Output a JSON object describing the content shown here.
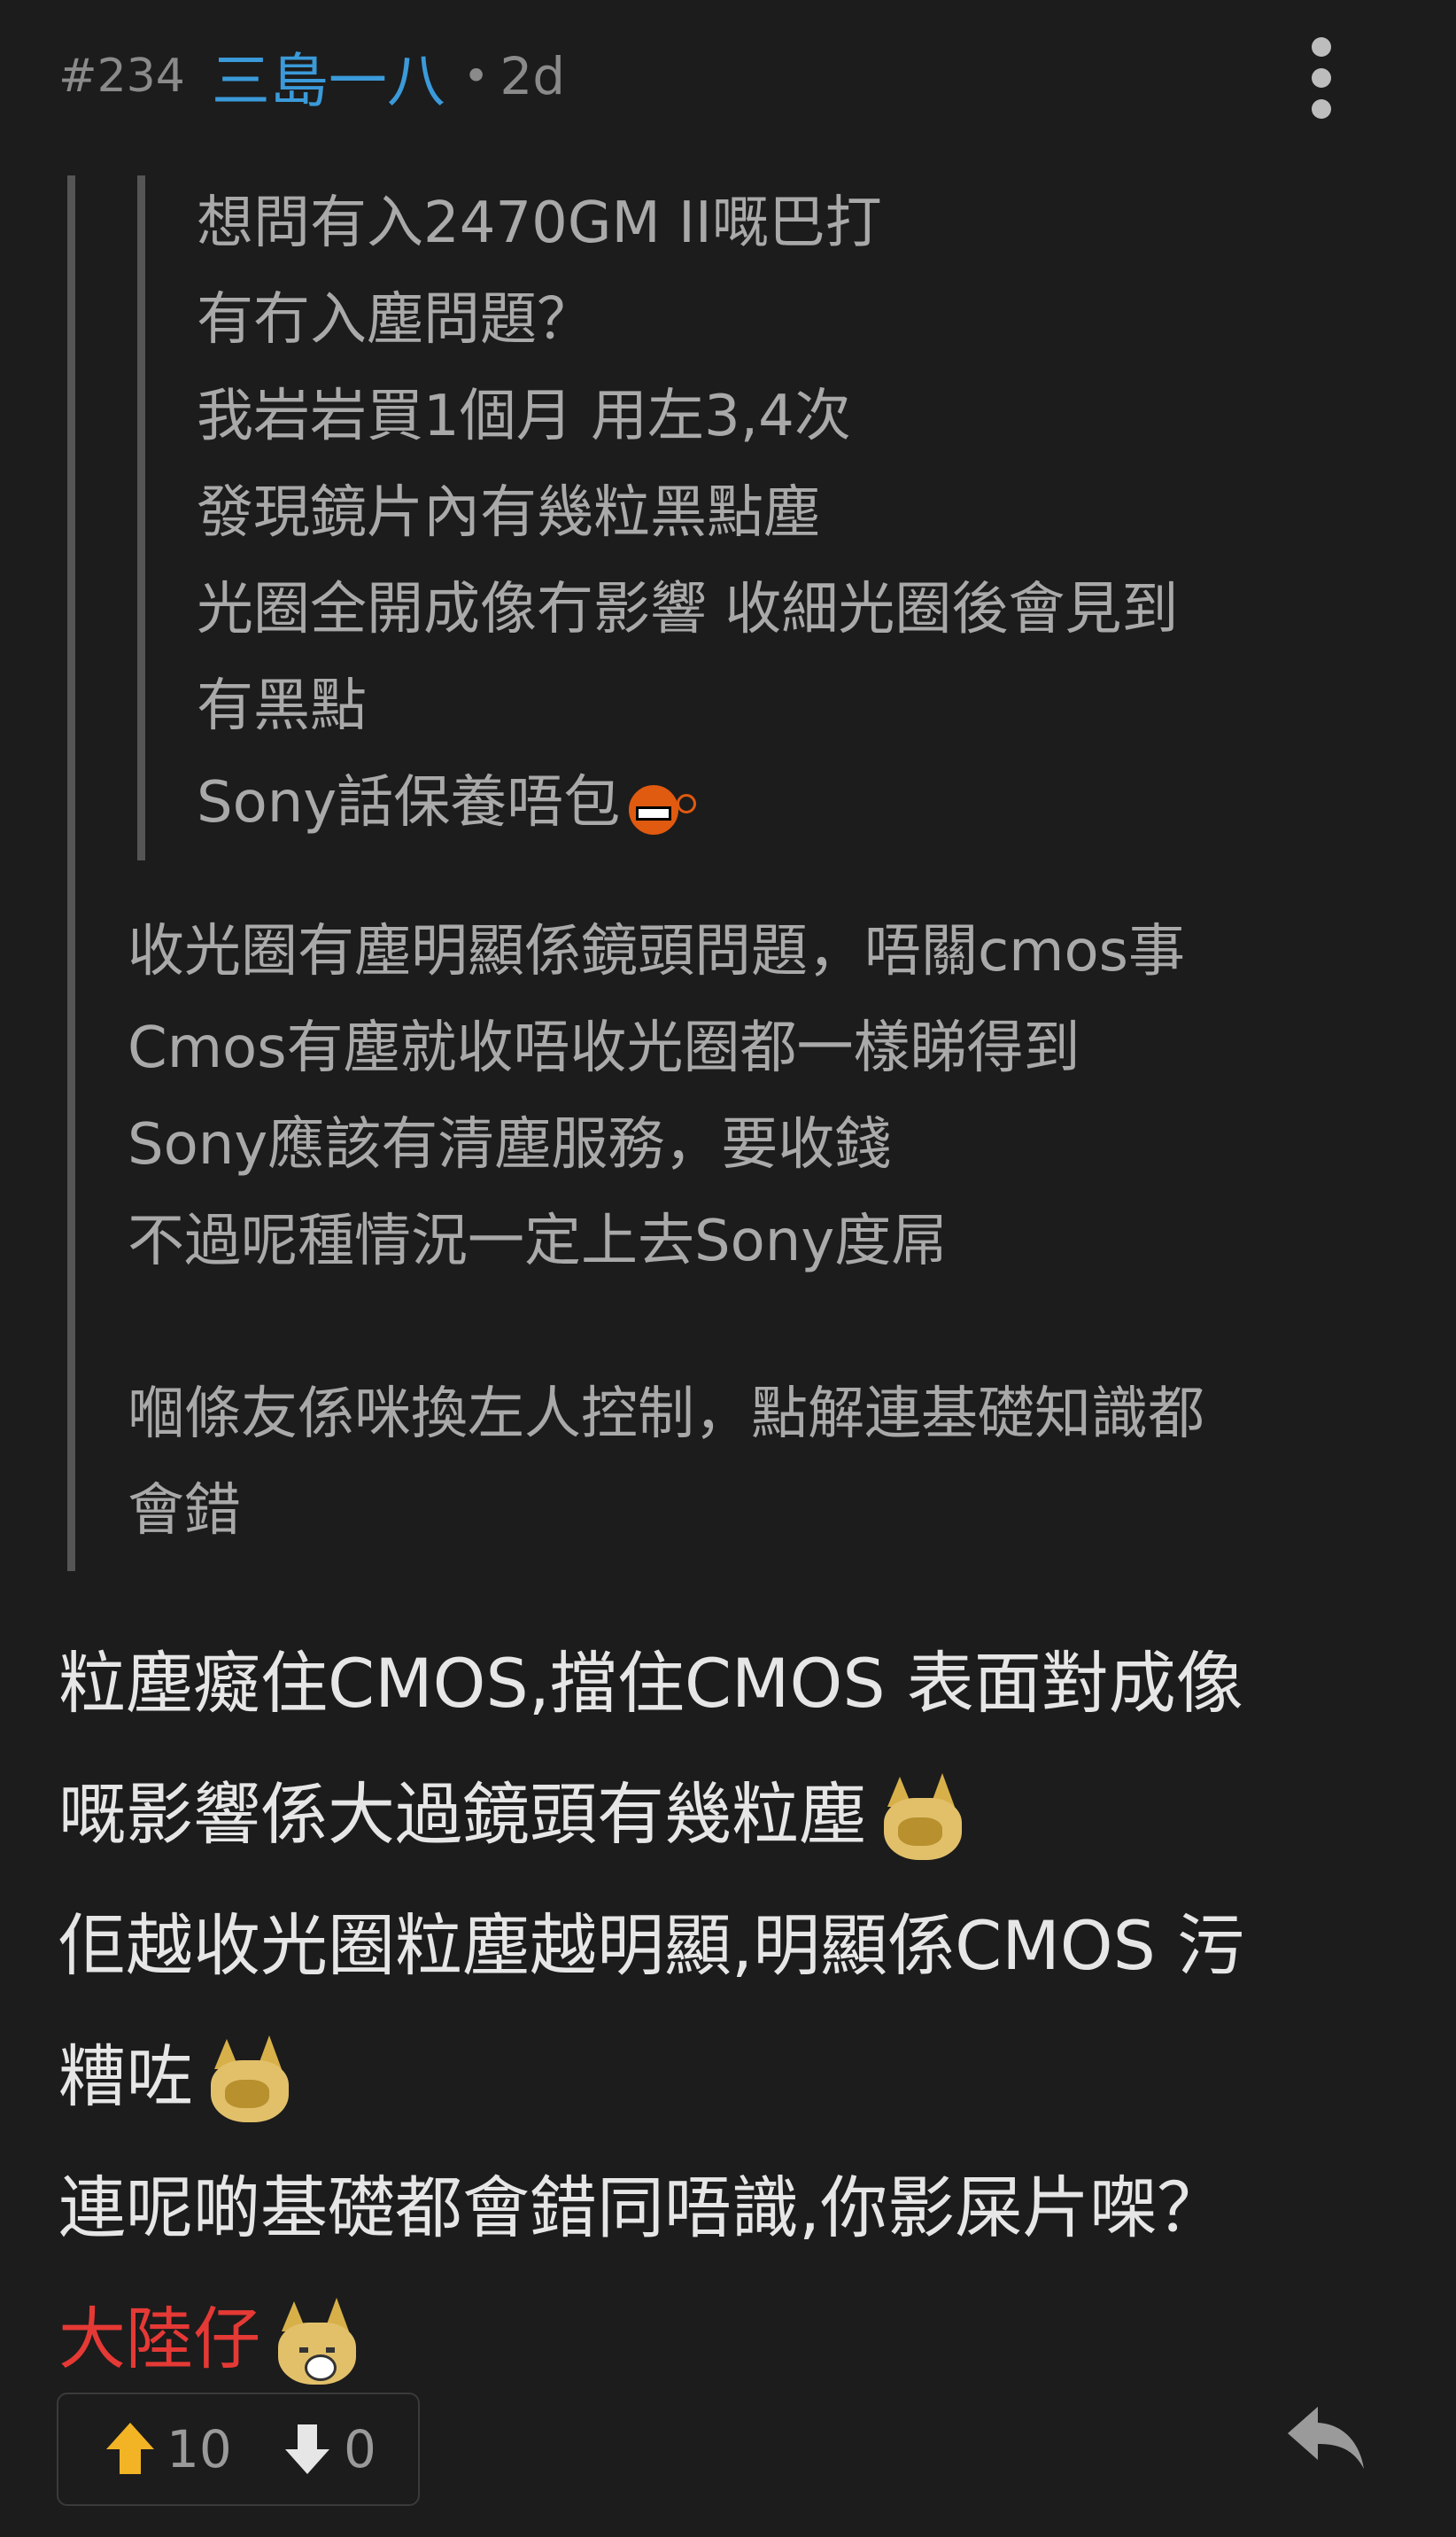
{
  "post": {
    "number": "#234",
    "username": "三島一八",
    "separator": "•",
    "time": "2d"
  },
  "icons": {
    "more": "more-vertical-icon",
    "reply": "reply-icon",
    "upvote": "arrow-up-icon",
    "downvote": "arrow-down-icon",
    "emoji_angry": "angry-face-emoji",
    "emoji_dog": "facepalm-dog-emoji"
  },
  "colors": {
    "background": "#1c1c1c",
    "username": "#3b9ad9",
    "quote_text": "#a9a9a9",
    "body_text": "#e6e6e6",
    "highlight_red": "#e53935",
    "upvote": "#f2b325"
  },
  "inner_quote": {
    "lines": [
      "想問有入2470GM II嘅巴打",
      "有冇入塵問題？",
      "我岩岩買1個月 用左3,4次",
      "發現鏡片內有幾粒黑點塵",
      "光圈全開成像冇影響 收細光圈後會見到",
      "有黑點",
      "Sony話保養唔包"
    ]
  },
  "outer_quote": {
    "lines": [
      "收光圈有塵明顯係鏡頭問題，唔關cmos事",
      "Cmos有塵就收唔收光圈都一樣睇得到",
      "Sony應該有清塵服務，要收錢",
      "不過呢種情況一定上去Sony度屌",
      "嗰條友係咪換左人控制，點解連基礎知識都",
      "會錯"
    ]
  },
  "body": {
    "lines": [
      "粒塵癡住CMOS,擋住CMOS 表面對成像",
      "嘅影響係大過鏡頭有幾粒塵",
      "佢越收光圈粒塵越明顯,明顯係CMOS 污",
      "糟咗",
      "連呢啲基礎都會錯同唔識,你影屎片㗎？",
      "大陸仔"
    ]
  },
  "votes": {
    "up": "10",
    "down": "0"
  }
}
